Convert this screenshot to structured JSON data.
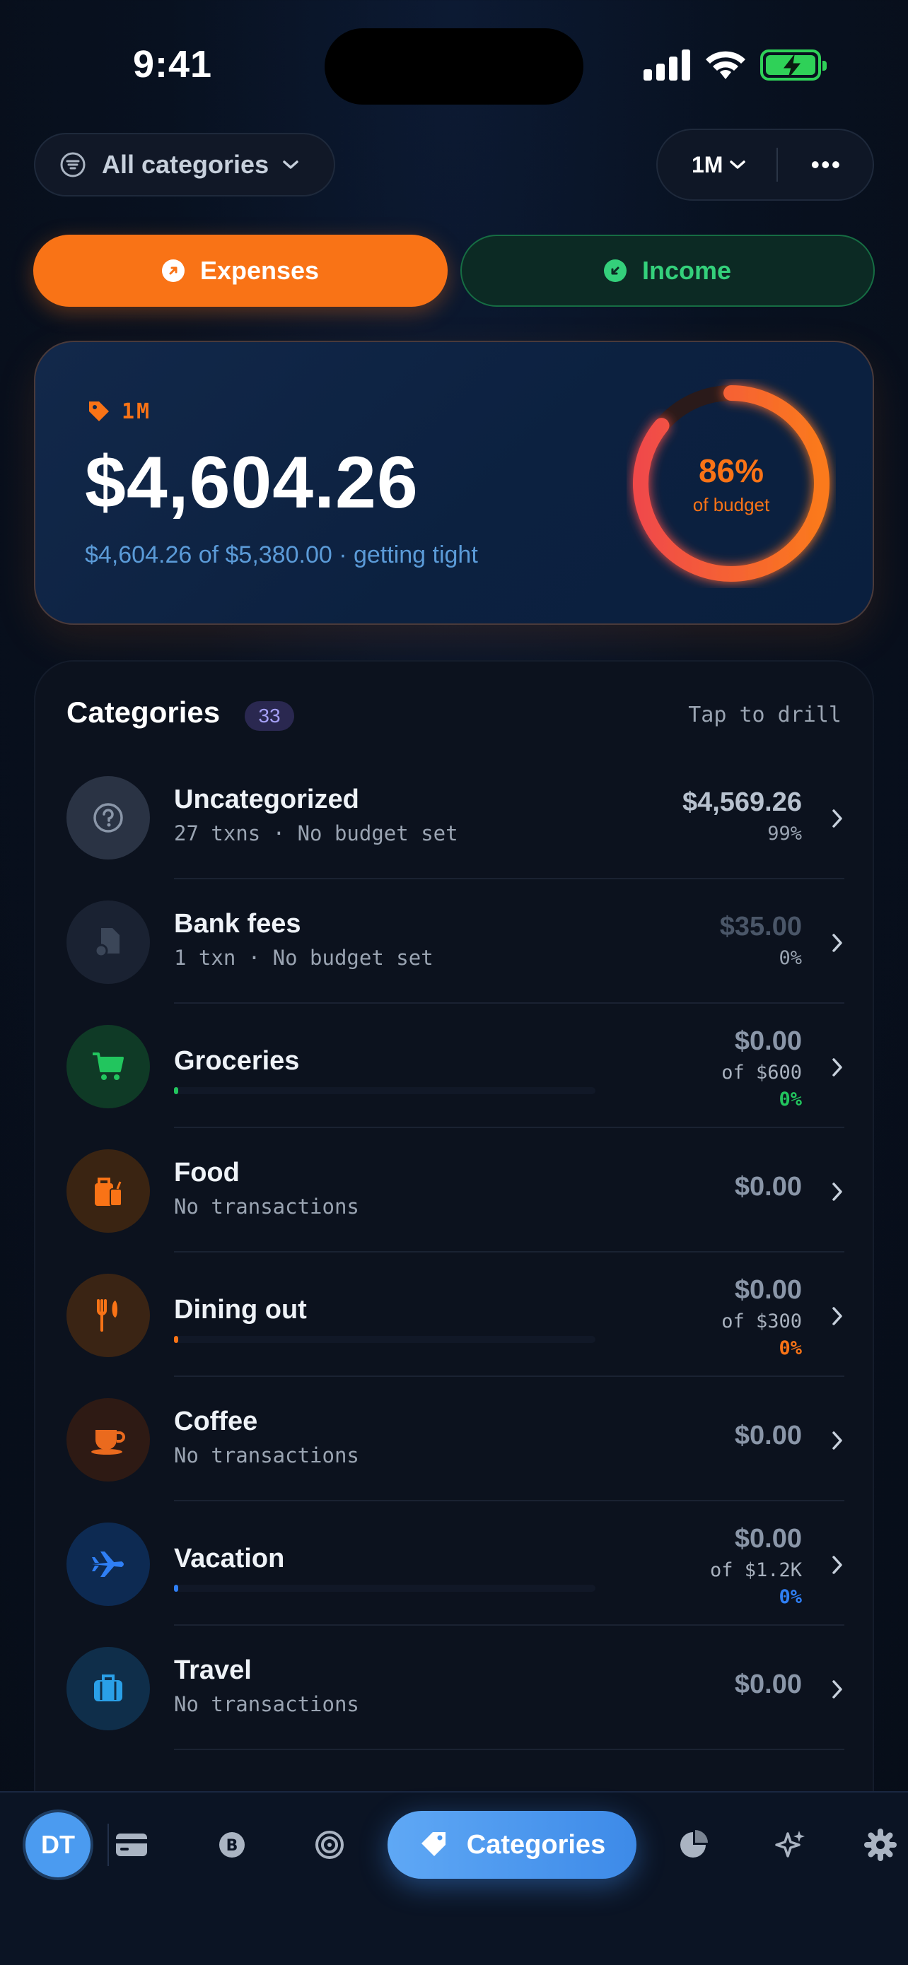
{
  "status_bar": {
    "time": "9:41"
  },
  "filter": {
    "label": "All categories",
    "period": "1M",
    "more": "•••"
  },
  "toggle": {
    "expenses": "Expenses",
    "income": "Income"
  },
  "summary": {
    "period_tag": "1M",
    "amount": "$4,604.26",
    "subtitle": "$4,604.26 of $5,380.00 · getting tight",
    "ring_percent": "86%",
    "ring_caption": "of budget",
    "ring_fraction": 0.86
  },
  "categories": {
    "title": "Categories",
    "count": "33",
    "hint": "Tap to drill",
    "rows": [
      {
        "name": "Uncategorized",
        "meta": "27 txns · No budget set",
        "amount": "$4,569.26",
        "percent": "99%",
        "icon": "question-icon",
        "tint": "#2a3344",
        "icon_color": "#8a96a8",
        "kind": "plain"
      },
      {
        "name": "Bank fees",
        "meta": "1 txn · No budget set",
        "amount": "$35.00",
        "percent": "0%",
        "icon": "bank-fees-icon",
        "tint": "#1a2232",
        "icon_color": "#3b4658",
        "kind": "plain",
        "dim": true
      },
      {
        "name": "Groceries",
        "amount": "$0.00",
        "of": "of $600",
        "percent": "0%",
        "icon": "cart-icon",
        "tint": "#0f3a26",
        "icon_color": "#22c55e",
        "accent": "#22c55e",
        "kind": "budget",
        "progress": 0
      },
      {
        "name": "Food",
        "meta": "No transactions",
        "amount": "$0.00",
        "icon": "food-icon",
        "tint": "#3a2412",
        "icon_color": "#f97316",
        "kind": "plain"
      },
      {
        "name": "Dining out",
        "amount": "$0.00",
        "of": "of $300",
        "percent": "0%",
        "icon": "utensils-icon",
        "tint": "#3a2414",
        "icon_color": "#f97316",
        "accent": "#f97316",
        "kind": "budget",
        "progress": 0
      },
      {
        "name": "Coffee",
        "meta": "No transactions",
        "amount": "$0.00",
        "icon": "coffee-icon",
        "tint": "#2e1a14",
        "icon_color": "#ea6a1e",
        "kind": "plain"
      },
      {
        "name": "Vacation",
        "amount": "$0.00",
        "of": "of $1.2K",
        "percent": "0%",
        "icon": "plane-icon",
        "tint": "#0d2a52",
        "icon_color": "#2f7ff5",
        "accent": "#2f7ff5",
        "kind": "budget",
        "progress": 0
      },
      {
        "name": "Travel",
        "meta": "No transactions",
        "amount": "$0.00",
        "icon": "suitcase-icon",
        "tint": "#0f2e4a",
        "icon_color": "#2aa0e8",
        "kind": "plain"
      }
    ]
  },
  "bottom_nav": {
    "avatar": "DT",
    "active_label": "Categories",
    "items": [
      "card-icon",
      "bitcoin-icon",
      "target-icon",
      "tag-icon",
      "pie-chart-icon",
      "sparkle-icon",
      "gear-icon"
    ]
  },
  "colors": {
    "accent_orange": "#f97316",
    "accent_green": "#34d07b",
    "accent_blue": "#3d8ae8"
  }
}
